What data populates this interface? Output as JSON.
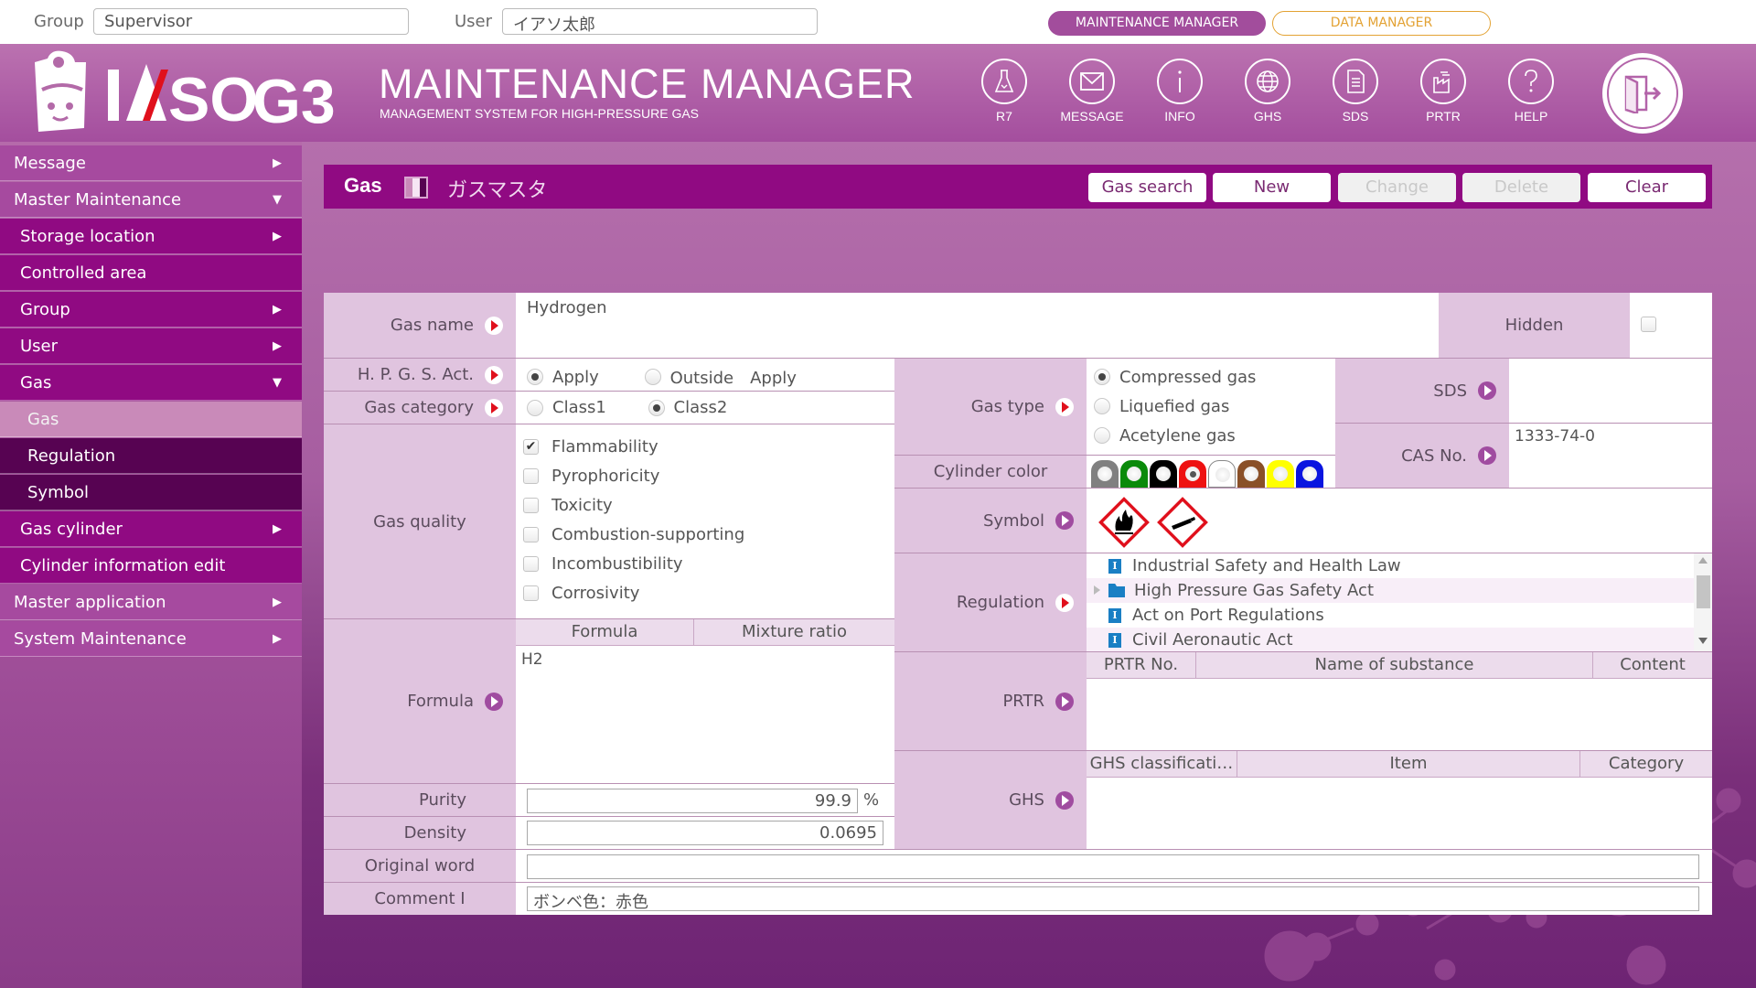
{
  "topbar": {
    "group_label": "Group",
    "group_value": "Supervisor",
    "user_label": "User",
    "user_value": "イアソ太郎",
    "mode_maintenance": "MAINTENANCE MANAGER",
    "mode_data": "DATA MANAGER"
  },
  "header": {
    "logo_text": "IASO G3",
    "title": "MAINTENANCE MANAGER",
    "subtitle": "MANAGEMENT SYSTEM FOR HIGH-PRESSURE GAS",
    "nav": [
      {
        "label": "R7",
        "icon": "flask-icon"
      },
      {
        "label": "MESSAGE",
        "icon": "envelope-icon"
      },
      {
        "label": "INFO",
        "icon": "info-icon"
      },
      {
        "label": "GHS",
        "icon": "globe-icon"
      },
      {
        "label": "SDS",
        "icon": "document-icon"
      },
      {
        "label": "PRTR",
        "icon": "factory-icon"
      },
      {
        "label": "HELP",
        "icon": "question-icon"
      }
    ],
    "logout_icon": "logout-door-icon"
  },
  "sidebar": {
    "items": [
      {
        "label": "Message",
        "level": 1,
        "arrow": "right"
      },
      {
        "label": "Master Maintenance",
        "level": 1,
        "arrow": "down"
      },
      {
        "label": "Storage location",
        "level": 2,
        "arrow": "right"
      },
      {
        "label": "Controlled area",
        "level": 2,
        "arrow": ""
      },
      {
        "label": "Group",
        "level": 2,
        "arrow": "right"
      },
      {
        "label": "User",
        "level": 2,
        "arrow": "right"
      },
      {
        "label": "Gas",
        "level": 2,
        "arrow": "down"
      },
      {
        "label": "Gas",
        "level": 3,
        "arrow": "",
        "active": true
      },
      {
        "label": "Regulation",
        "level": 3,
        "arrow": ""
      },
      {
        "label": "Symbol",
        "level": 3,
        "arrow": ""
      },
      {
        "label": "Gas cylinder",
        "level": 2,
        "arrow": "right"
      },
      {
        "label": "Cylinder information edit",
        "level": 2,
        "arrow": ""
      },
      {
        "label": "Master application",
        "level": 1,
        "arrow": "right"
      },
      {
        "label": "System Maintenance",
        "level": 1,
        "arrow": "right"
      }
    ]
  },
  "titlebar": {
    "title": "Gas",
    "subtitle": "ガスマスタ",
    "buttons": {
      "gas_search": "Gas search",
      "new": "New",
      "change": "Change",
      "delete": "Delete",
      "clear": "Clear"
    }
  },
  "form": {
    "gas_name": {
      "label": "Gas name",
      "value": "Hydrogen"
    },
    "hidden": {
      "label": "Hidden",
      "checked": false
    },
    "hpgs_act": {
      "label": "H. P. G. S. Act.",
      "options": [
        "Apply",
        "Outside　Apply"
      ],
      "selected": "Apply"
    },
    "gas_category": {
      "label": "Gas category",
      "options": [
        "Class1",
        "Class2"
      ],
      "selected": "Class2"
    },
    "gas_quality": {
      "label": "Gas quality",
      "options": [
        {
          "label": "Flammability",
          "checked": true
        },
        {
          "label": "Pyrophoricity",
          "checked": false
        },
        {
          "label": "Toxicity",
          "checked": false
        },
        {
          "label": "Combustion-supporting",
          "checked": false
        },
        {
          "label": "Incombustibility",
          "checked": false
        },
        {
          "label": "Corrosivity",
          "checked": false
        }
      ]
    },
    "formula": {
      "label": "Formula",
      "columns": [
        "Formula",
        "Mixture ratio"
      ],
      "rows": [
        [
          "H2",
          ""
        ]
      ]
    },
    "purity": {
      "label": "Purity",
      "value": "99.9",
      "unit": "%"
    },
    "density": {
      "label": "Density",
      "value": "0.0695"
    },
    "original_word": {
      "label": "Original word",
      "value": ""
    },
    "comment": {
      "label": "Comment Ⅰ",
      "value": "ボンベ色：赤色"
    },
    "gas_type": {
      "label": "Gas type",
      "options": [
        "Compressed gas",
        "Liquefied gas",
        "Acetylene gas"
      ],
      "selected": "Compressed gas"
    },
    "cylinder_color": {
      "label": "Cylinder color",
      "colors": [
        "#808080",
        "#0a8a0a",
        "#000000",
        "#ee1111",
        "#ffffff",
        "#8a5028",
        "#ffff00",
        "#0a14e0"
      ],
      "selected_index": 3
    },
    "symbol": {
      "label": "Symbol",
      "items": [
        "GHS02 flame",
        "GHS04 gas cylinder"
      ]
    },
    "regulation": {
      "label": "Regulation",
      "items": [
        {
          "label": "Industrial Safety and Health Law",
          "type": "item"
        },
        {
          "label": "High Pressure Gas Safety Act",
          "type": "folder"
        },
        {
          "label": "Act on Port Regulations",
          "type": "item"
        },
        {
          "label": "Civil Aeronautic Act",
          "type": "item"
        }
      ]
    },
    "prtr": {
      "label": "PRTR",
      "columns": [
        "PRTR No.",
        "Name of substance",
        "Content"
      ],
      "rows": []
    },
    "ghs": {
      "label": "GHS",
      "columns": [
        "GHS classificati…",
        "Item",
        "Category"
      ],
      "rows": []
    },
    "sds": {
      "label": "SDS",
      "value": ""
    },
    "cas_no": {
      "label": "CAS No.",
      "value": "1333-74-0"
    }
  }
}
